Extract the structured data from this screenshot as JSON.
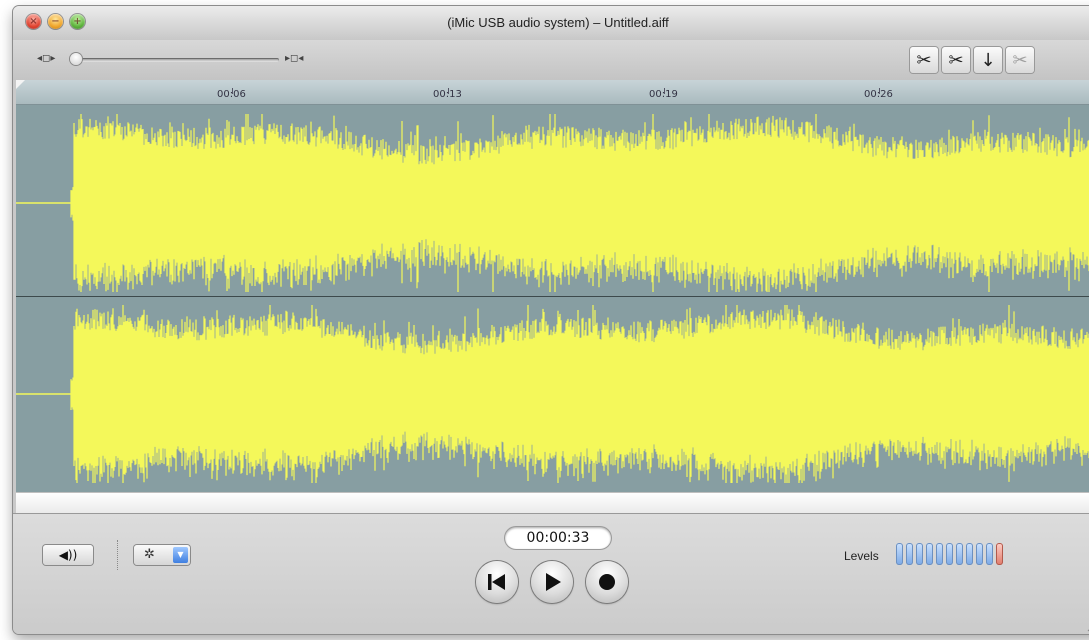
{
  "window": {
    "title": "(iMic USB audio system) – Untitled.aiff",
    "traffic_symbols": [
      "×",
      "−",
      "+"
    ]
  },
  "toolbar": {
    "zoom_out_icon": "◂◻▸",
    "zoom_in_icon": "▸◻◂",
    "zoom_level": 0,
    "edit_buttons": [
      {
        "icon": "scissors-cut-icon",
        "glyph": "✂",
        "enabled": true
      },
      {
        "icon": "scissors-crop-icon",
        "glyph": "✂",
        "enabled": true
      },
      {
        "icon": "insert-icon",
        "glyph": "↓",
        "enabled": true
      },
      {
        "icon": "split-icon",
        "glyph": "✂",
        "enabled": false
      }
    ]
  },
  "ruler": {
    "ticks": [
      "00:06",
      "00:13",
      "00:19",
      "00:26"
    ]
  },
  "waveform": {
    "color": "#f4f85a",
    "background": "#879ea2",
    "channels": 2
  },
  "controls": {
    "speaker_glyph": "◀))",
    "action_glyph": "✲",
    "dropdown_glyph": "▼",
    "timecode": "00:00:33",
    "levels_label": "Levels",
    "level_bars": 11,
    "level_active": 0
  }
}
